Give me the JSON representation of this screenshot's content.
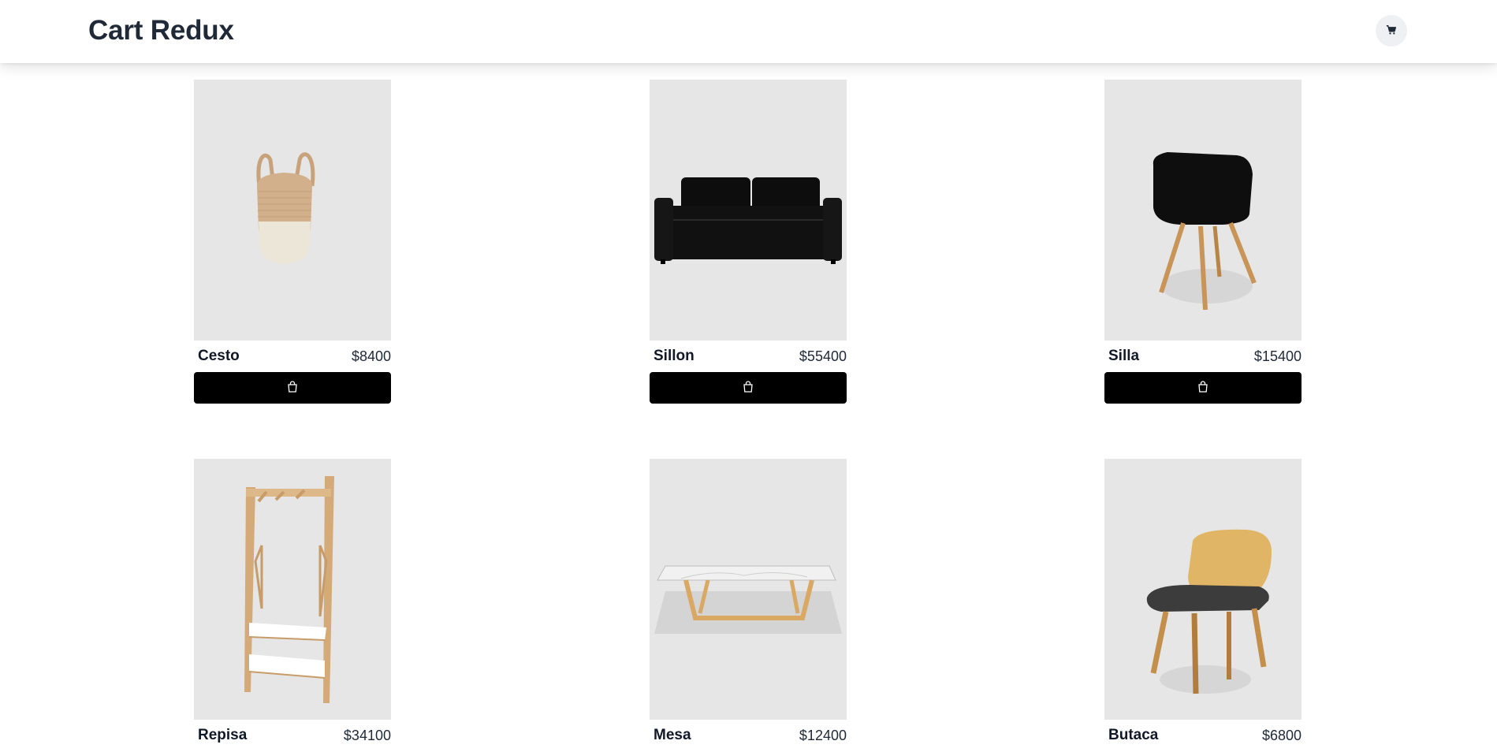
{
  "header": {
    "title": "Cart Redux",
    "cart_icon": "shopping-cart-icon"
  },
  "products": [
    {
      "name": "Cesto",
      "price": "$8400",
      "image": "basket",
      "button_icon": "shopping-bag-icon"
    },
    {
      "name": "Sillon",
      "price": "$55400",
      "image": "sofa",
      "button_icon": "shopping-bag-icon"
    },
    {
      "name": "Silla",
      "price": "$15400",
      "image": "chair",
      "button_icon": "shopping-bag-icon"
    },
    {
      "name": "Repisa",
      "price": "$34100",
      "image": "shelf",
      "button_icon": "shopping-bag-icon"
    },
    {
      "name": "Mesa",
      "price": "$12400",
      "image": "table",
      "button_icon": "shopping-bag-icon"
    },
    {
      "name": "Butaca",
      "price": "$6800",
      "image": "armchair",
      "button_icon": "shopping-bag-icon"
    }
  ],
  "colors": {
    "header_bg": "#ffffff",
    "card_bg": "#e6e6e6",
    "button_bg": "#000000",
    "cart_button_bg": "#eef0f3"
  }
}
